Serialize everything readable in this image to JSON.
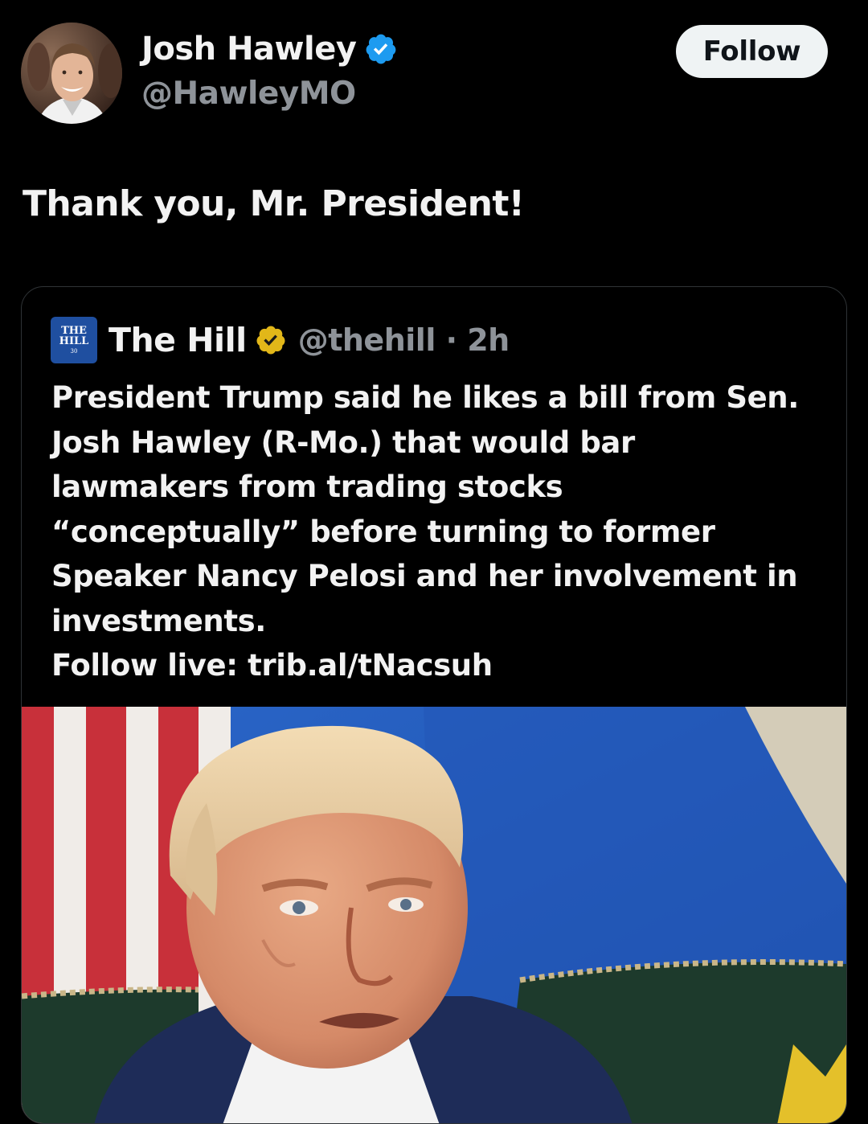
{
  "tweet": {
    "author": {
      "name": "Josh Hawley",
      "handle": "@HawleyMO",
      "avatar_icon": "avatar-photo",
      "verified_icon": "verified-badge-blue-icon"
    },
    "follow_label": "Follow",
    "text": "Thank you, Mr. President!"
  },
  "quote": {
    "logo_lines": [
      "THE",
      "HILL",
      "30"
    ],
    "name": "The Hill",
    "verified_icon": "verified-badge-gold-icon",
    "handle_time": "@thehill · 2h",
    "body_lines": [
      "President Trump said he likes a bill from Sen.",
      "Josh Hawley (R-Mo.) that would bar",
      "lawmakers from trading stocks",
      "“conceptually” before turning to former",
      "Speaker Nancy Pelosi and her involvement in",
      "investments.",
      "Follow live: trib.al/tNacsuh"
    ],
    "media_icon": "photo-of-donald-trump"
  },
  "colors": {
    "background": "#000000",
    "text": "#f2f2f2",
    "secondary_text": "#8e9399",
    "verified_blue": "#1d9bf0",
    "verified_gold": "#e2b719",
    "follow_button_bg": "#eff3f4"
  }
}
